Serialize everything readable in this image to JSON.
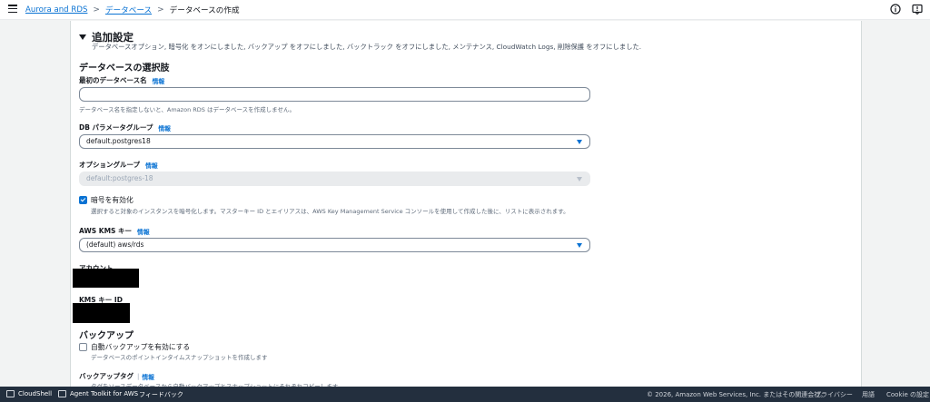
{
  "breadcrumb": {
    "items": [
      "Aurora and RDS",
      "データベース"
    ],
    "current": "データベースの作成"
  },
  "section": {
    "title": "追加設定",
    "description": "データベースオプション, 暗号化 をオンにしました, バックアップ をオフにしました, バックトラック をオフにしました, メンテナンス, CloudWatch Logs, 削除保護 をオフにしました."
  },
  "db_options": {
    "heading": "データベースの選択肢",
    "initial_db_name": {
      "label": "最初のデータベース名",
      "info": "情報",
      "value": "",
      "hint": "データベース名を指定しないと、Amazon RDS はデータベースを作成しません。"
    },
    "param_group": {
      "label": "DB パラメータグループ",
      "info": "情報",
      "value": "default.postgres18"
    },
    "option_group": {
      "label": "オプショングループ",
      "info": "情報",
      "value": "default:postgres-18"
    }
  },
  "encryption": {
    "checkbox_label": "暗号を有効化",
    "checked": true,
    "hint": "選択すると対象のインスタンスを暗号化します。マスターキー ID とエイリアスは、AWS Key Management Service コンソールを使用して作成した後に、リストに表示されます。",
    "kms_key": {
      "label": "AWS KMS キー",
      "info": "情報",
      "value": "(default) aws/rds"
    },
    "account_label": "アカウント",
    "kms_key_id_label": "KMS キー ID"
  },
  "backup": {
    "heading": "バックアップ",
    "auto_backup_label": "自動バックアップを有効にする",
    "auto_backup_checked": false,
    "auto_backup_hint": "データベースのポイントインタイムスナップショットを作成します",
    "tags_label": "バックアップタグ",
    "tags_info": "情報",
    "tags_hint": "タグをソースデータベースから自動バックアップとスナップショットにそれぞれコピーします"
  },
  "footer": {
    "cloudshell": "CloudShell",
    "toolkit": "Agent Toolkit for AWS",
    "feedback": "フィードバック",
    "copyright": "© 2026, Amazon Web Services, Inc. またはその関連会社。",
    "privacy": "プライバシー",
    "terms": "用語",
    "cookies": "Cookie の設定"
  },
  "colors": {
    "link": "#0972d3",
    "footer_bg": "#232f3e",
    "checkbox_on": "#0972d3"
  }
}
